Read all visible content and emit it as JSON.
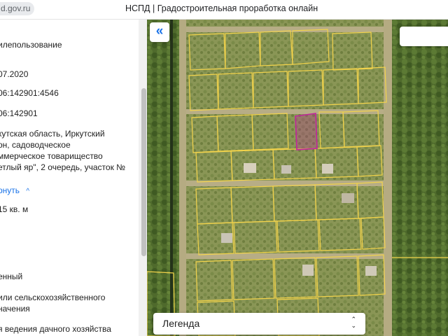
{
  "browser": {
    "url_fragment": "d.gov.ru",
    "page_title": "НСПД | Градостроительная проработка онлайн"
  },
  "sidebar": {
    "lines": [
      "илепользование",
      "07.2020",
      "06:142901:4546",
      "06:142901",
      "кутская область, Иркутский",
      "он, садоводческое",
      "ммерческое товарищество",
      "етлый яр\", 2 очередь, участок №",
      "",
      "15 кв. м",
      "енный",
      "или сельскохозяйственного",
      "начения",
      "я ведения дачного хозяйства"
    ],
    "collapse_link": "рнуть",
    "collapse_chevron": "^"
  },
  "map": {
    "collapse_button": "«",
    "legend_label": "Легенда",
    "legend_arrow_up": "⌃",
    "legend_arrow_down": "⌄",
    "parcel_outline_color": "#f2d34b",
    "selected_parcel_color": "#c2259e",
    "base_color": "#7d8c4d"
  }
}
